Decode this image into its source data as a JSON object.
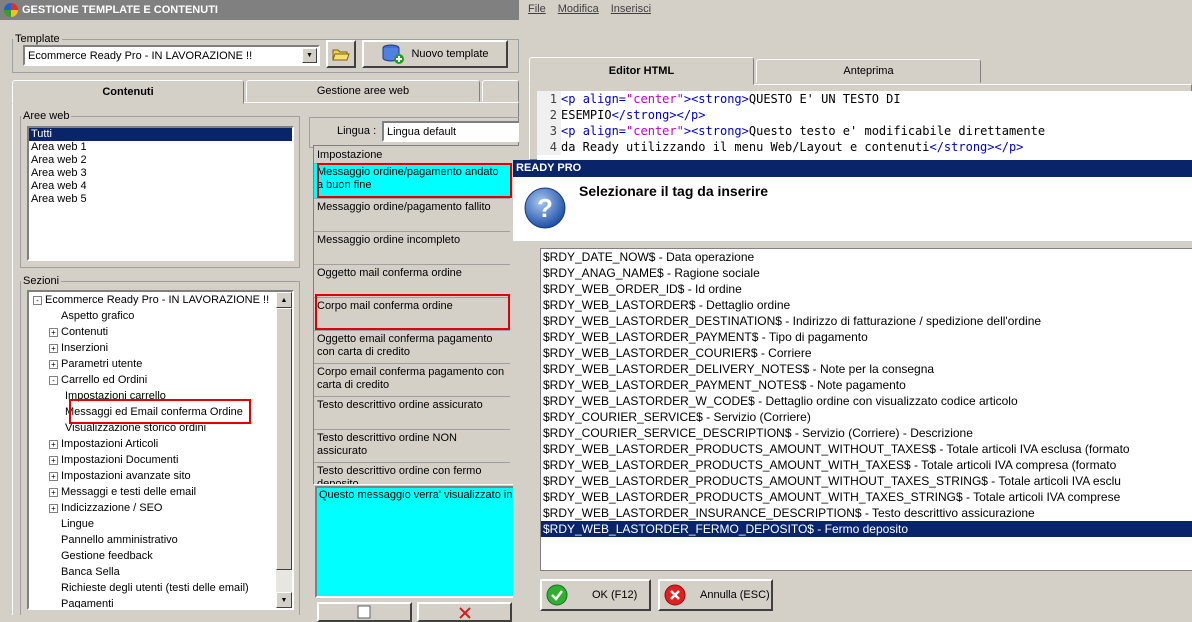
{
  "main_window": {
    "title": "GESTIONE TEMPLATE E CONTENUTI",
    "template_group_label": "Template",
    "template_selected": "Ecommerce Ready Pro - IN LAVORAZIONE !!",
    "new_template_label": "Nuovo template",
    "tabs": [
      "Contenuti",
      "Gestione aree web"
    ],
    "aree_web_label": "Aree web",
    "aree_web": [
      "Tutti",
      "Area web 1",
      "Area web 2",
      "Area web 3",
      "Area web 4",
      "Area web 5"
    ],
    "sezioni_label": "Sezioni",
    "tree": [
      {
        "label": "Ecommerce Ready Pro - IN LAVORAZIONE !!",
        "level": 0,
        "expander": "-"
      },
      {
        "label": "Aspetto grafico",
        "level": 1,
        "expander": ""
      },
      {
        "label": "Contenuti",
        "level": 1,
        "expander": "+"
      },
      {
        "label": "Inserzioni",
        "level": 1,
        "expander": "+"
      },
      {
        "label": "Parametri utente",
        "level": 1,
        "expander": "+"
      },
      {
        "label": "Carrello ed Ordini",
        "level": 1,
        "expander": "-"
      },
      {
        "label": "Impostazioni carrello",
        "level": 2,
        "expander": ""
      },
      {
        "label": "Messaggi ed Email conferma Ordine",
        "level": 2,
        "expander": ""
      },
      {
        "label": "Visualizzazione storico ordini",
        "level": 2,
        "expander": ""
      },
      {
        "label": "Impostazioni Articoli",
        "level": 1,
        "expander": "+"
      },
      {
        "label": "Impostazioni Documenti",
        "level": 1,
        "expander": "+"
      },
      {
        "label": "Impostazioni avanzate sito",
        "level": 1,
        "expander": "+"
      },
      {
        "label": "Messaggi e testi delle email",
        "level": 1,
        "expander": "+"
      },
      {
        "label": "Indicizzazione / SEO",
        "level": 1,
        "expander": "+"
      },
      {
        "label": "Lingue",
        "level": 1,
        "expander": ""
      },
      {
        "label": "Pannello amministrativo",
        "level": 1,
        "expander": ""
      },
      {
        "label": "Gestione feedback",
        "level": 1,
        "expander": ""
      },
      {
        "label": "Banca Sella",
        "level": 1,
        "expander": ""
      },
      {
        "label": "Richieste degli utenti (testi delle email)",
        "level": 1,
        "expander": ""
      },
      {
        "label": "Pagamenti",
        "level": 1,
        "expander": ""
      }
    ],
    "lingua_label": "Lingua :",
    "lingua_value": "Lingua default",
    "impostazione_header": "Impostazione",
    "settings": [
      "Messaggio ordine/pagamento andato a buon fine",
      "Messaggio ordine/pagamento fallito",
      "Messaggio ordine incompleto",
      "Oggetto mail conferma ordine",
      "Corpo mail conferma ordine",
      "Oggetto email conferma pagamento con carta di credito",
      "Corpo email conferma pagamento con carta di credito",
      "Testo descrittivo ordine assicurato",
      "Testo descrittivo ordine NON assicurato",
      "Testo descrittivo ordine con fermo deposito"
    ],
    "preview_text": "Questo messaggio verra' visualizzato in"
  },
  "editor": {
    "menu": [
      "File",
      "Modifica",
      "Inserisci"
    ],
    "tabs": [
      "Editor HTML",
      "Anteprima"
    ],
    "lines": [
      {
        "num": "1",
        "parts": [
          [
            "tag",
            "<p "
          ],
          [
            "att",
            "align="
          ],
          [
            "str",
            "\"center\""
          ],
          [
            "tag",
            "><strong>"
          ],
          [
            "txt",
            "QUESTO E' UN TESTO DI"
          ]
        ]
      },
      {
        "num": "2",
        "parts": [
          [
            "txt",
            "ESEMPIO"
          ],
          [
            "tag",
            "</strong></p>"
          ]
        ]
      },
      {
        "num": "3",
        "parts": [
          [
            "tag",
            "<p "
          ],
          [
            "att",
            "align="
          ],
          [
            "str",
            "\"center\""
          ],
          [
            "tag",
            "><strong>"
          ],
          [
            "txt",
            "Questo testo e' modificabile direttamente"
          ]
        ]
      },
      {
        "num": "4",
        "parts": [
          [
            "txt",
            "da Ready utilizzando il menu Web/Layout e contenuti"
          ],
          [
            "tag",
            "</strong></p>"
          ]
        ]
      }
    ]
  },
  "dialog": {
    "title": "READY PRO",
    "heading": "Selezionare il tag da inserire",
    "items": [
      "$RDY_DATE_NOW$ - Data operazione",
      "$RDY_ANAG_NAME$ - Ragione sociale",
      "$RDY_WEB_ORDER_ID$ - Id ordine",
      "$RDY_WEB_LASTORDER$ - Dettaglio ordine",
      "$RDY_WEB_LASTORDER_DESTINATION$ - Indirizzo di fatturazione / spedizione dell'ordine",
      "$RDY_WEB_LASTORDER_PAYMENT$ - Tipo di pagamento",
      "$RDY_WEB_LASTORDER_COURIER$ - Corriere",
      "$RDY_WEB_LASTORDER_DELIVERY_NOTES$ - Note per la consegna",
      "$RDY_WEB_LASTORDER_PAYMENT_NOTES$ - Note pagamento",
      "$RDY_WEB_LASTORDER_W_CODE$ - Dettaglio ordine con visualizzato codice articolo",
      "$RDY_COURIER_SERVICE$ - Servizio (Corriere)",
      "$RDY_COURIER_SERVICE_DESCRIPTION$ - Servizio (Corriere) - Descrizione",
      "$RDY_WEB_LASTORDER_PRODUCTS_AMOUNT_WITHOUT_TAXES$ - Totale articoli IVA esclusa (formato",
      "$RDY_WEB_LASTORDER_PRODUCTS_AMOUNT_WITH_TAXES$ - Totale articoli IVA compresa (formato",
      "$RDY_WEB_LASTORDER_PRODUCTS_AMOUNT_WITHOUT_TAXES_STRING$ - Totale articoli IVA esclu",
      "$RDY_WEB_LASTORDER_PRODUCTS_AMOUNT_WITH_TAXES_STRING$ - Totale articoli IVA comprese",
      "$RDY_WEB_LASTORDER_INSURANCE_DESCRIPTION$ - Testo descrittivo assicurazione",
      "$RDY_WEB_LASTORDER_FERMO_DEPOSITO$ - Fermo deposito"
    ],
    "selected_index": 17,
    "ok_label": "OK (F12)",
    "cancel_label": "Annulla (ESC)"
  }
}
